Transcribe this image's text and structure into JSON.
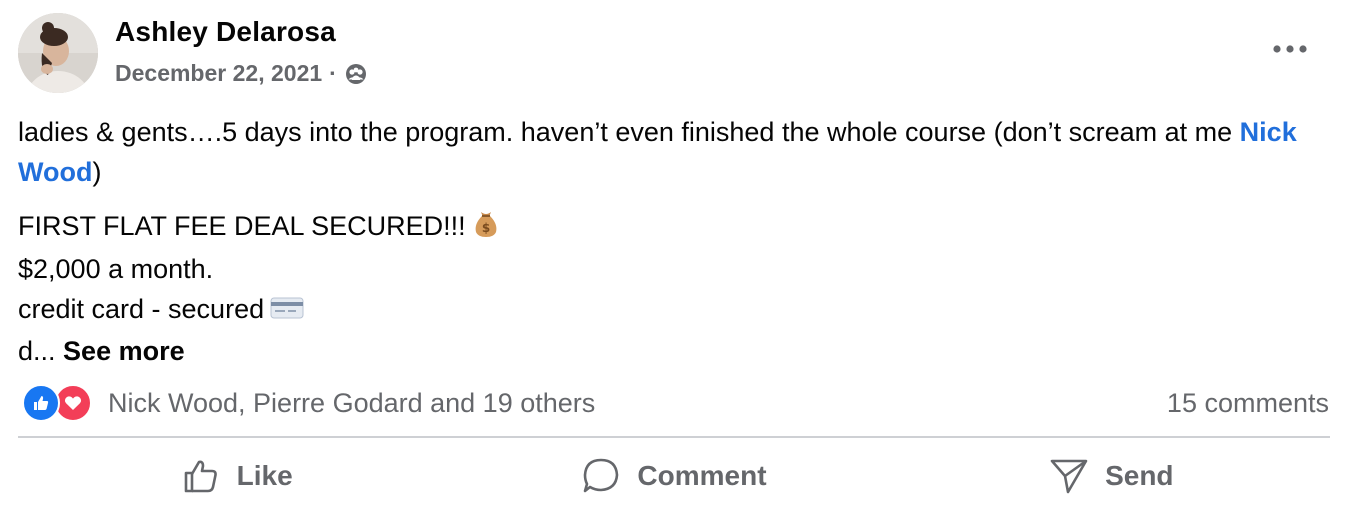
{
  "post": {
    "author": "Ashley Delarosa",
    "date": "December 22, 2021",
    "separator": "·",
    "audience_icon": "friends-icon",
    "more_icon": "ellipsis-icon"
  },
  "body": {
    "para1_text": "ladies & gents….5 days into the program. haven’t even finished the whole course (don’t scream at me ",
    "para1_mention": "Nick Wood",
    "para1_close": ")",
    "line1": "FIRST FLAT FEE DEAL SECURED!!!",
    "line1_emoji": "money-bag-icon",
    "line2": "$2,000 a month.",
    "line3": "credit card - secured",
    "line3_emoji": "credit-card-icon",
    "line4": "d...",
    "see_more": "See more"
  },
  "reactions": {
    "types": [
      "like",
      "love"
    ],
    "names": "Nick Wood, Pierre Godard and 19 others",
    "comments": "15 comments"
  },
  "actions": {
    "like": "Like",
    "comment": "Comment",
    "send": "Send"
  },
  "colors": {
    "mention": "#216fdb",
    "secondary_text": "#65676b",
    "like_blue": "#1877f2",
    "love_red": "#f33e58",
    "divider": "#ced0d4"
  }
}
